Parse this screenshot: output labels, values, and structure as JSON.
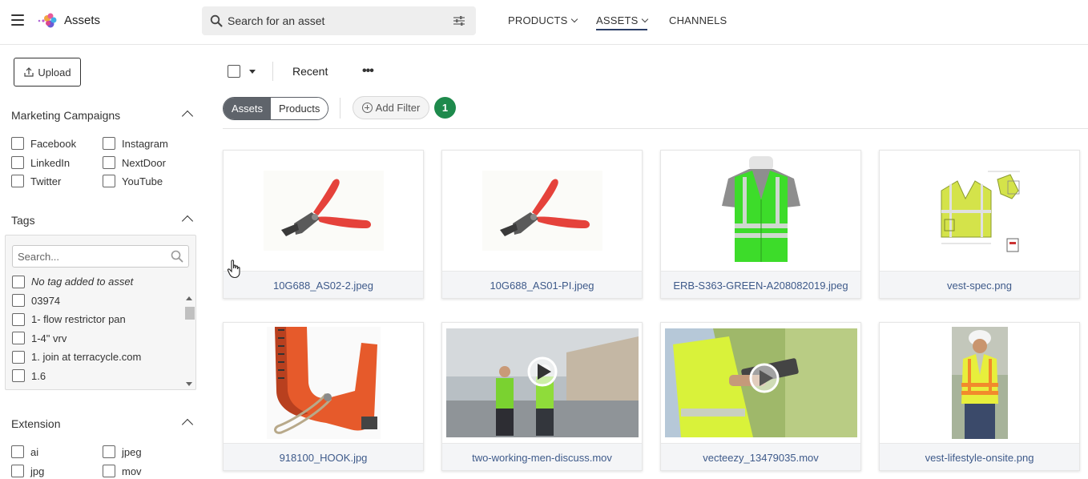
{
  "header": {
    "app_title": "Assets",
    "search_placeholder": "Search for an asset",
    "nav": [
      {
        "label": "PRODUCTS",
        "has_menu": true,
        "active": false
      },
      {
        "label": "ASSETS",
        "has_menu": true,
        "active": true
      },
      {
        "label": "CHANNELS",
        "has_menu": false,
        "active": false
      }
    ]
  },
  "sidebar": {
    "upload_label": "Upload",
    "marketing": {
      "title": "Marketing Campaigns",
      "options": [
        "Facebook",
        "Instagram",
        "LinkedIn",
        "NextDoor",
        "Twitter",
        "YouTube"
      ]
    },
    "tags": {
      "title": "Tags",
      "search_placeholder": "Search...",
      "items": [
        "No tag added to asset",
        "03974",
        "1- flow restrictor pan",
        "1-4\" vrv",
        "1. join at terracycle.com",
        "1.6"
      ]
    },
    "extension": {
      "title": "Extension",
      "options": [
        "ai",
        "jpeg",
        "jpg",
        "mov"
      ]
    }
  },
  "toolbar": {
    "sort_label": "Recent",
    "more_label": "•••",
    "segments": [
      "Assets",
      "Products"
    ],
    "add_filter_label": "Add Filter",
    "filter_count": "1"
  },
  "assets": [
    {
      "filename": "10G688_AS02-2.jpeg",
      "kind": "pliers-image"
    },
    {
      "filename": "10G688_AS01-PI.jpeg",
      "kind": "pliers-image"
    },
    {
      "filename": "ERB-S363-GREEN-A208082019.jpeg",
      "kind": "green-vest-image"
    },
    {
      "filename": "vest-spec.png",
      "kind": "vest-spec-image"
    },
    {
      "filename": "918100_HOOK.jpg",
      "kind": "hook-tool-image"
    },
    {
      "filename": "two-working-men-discuss.mov",
      "kind": "video"
    },
    {
      "filename": "vecteezy_13479035.mov",
      "kind": "video"
    },
    {
      "filename": "vest-lifestyle-onsite.png",
      "kind": "worker-photo"
    }
  ],
  "colors": {
    "accent_nav": "#2c3e66",
    "badge": "#1e8a4c",
    "filename_text": "#3e5a8a",
    "segment_active": "#5f646b"
  }
}
